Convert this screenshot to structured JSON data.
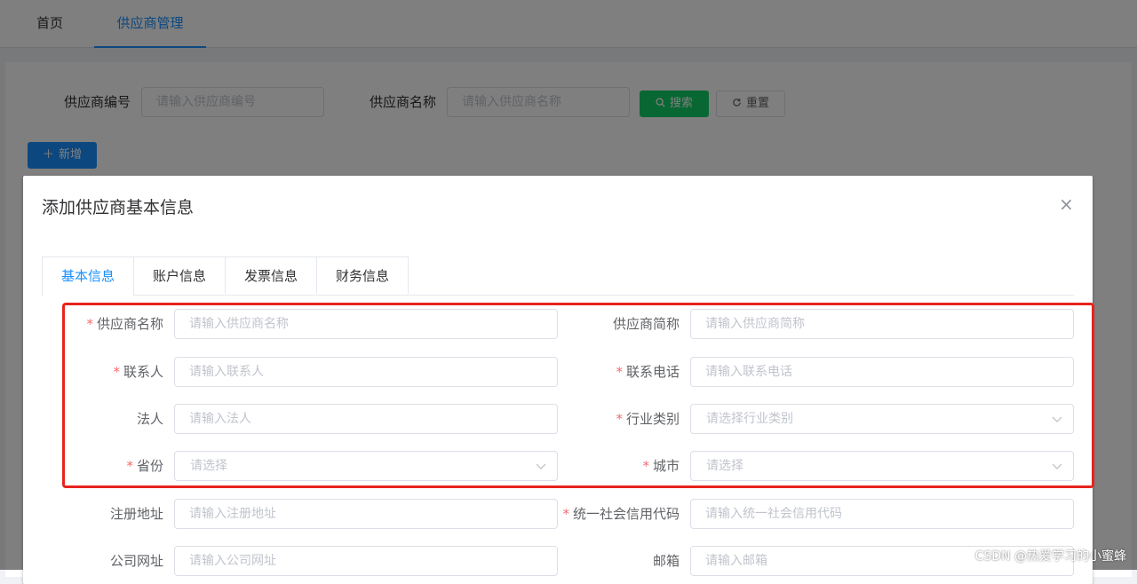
{
  "top_tabs": [
    {
      "label": "首页",
      "active": false
    },
    {
      "label": "供应商管理",
      "active": true
    }
  ],
  "search": {
    "code_label": "供应商编号",
    "code_placeholder": "请输入供应商编号",
    "name_label": "供应商名称",
    "name_placeholder": "请输入供应商名称",
    "search_button": "搜索",
    "reset_button": "重置",
    "add_button": "新增"
  },
  "dialog": {
    "title": "添加供应商基本信息",
    "close_icon": "×",
    "tabs": [
      "基本信息",
      "账户信息",
      "发票信息",
      "财务信息"
    ],
    "active_tab": "基本信息",
    "fields": {
      "supplier_name": {
        "label": "供应商名称",
        "required": true,
        "placeholder": "请输入供应商名称"
      },
      "supplier_short": {
        "label": "供应商简称",
        "required": false,
        "placeholder": "请输入供应商简称"
      },
      "contact": {
        "label": "联系人",
        "required": true,
        "placeholder": "请输入联系人"
      },
      "phone": {
        "label": "联系电话",
        "required": true,
        "placeholder": "请输入联系电话"
      },
      "legal_person": {
        "label": "法人",
        "required": false,
        "placeholder": "请输入法人"
      },
      "industry": {
        "label": "行业类别",
        "required": true,
        "placeholder": "请选择行业类别"
      },
      "province": {
        "label": "省份",
        "required": true,
        "placeholder": "请选择"
      },
      "city": {
        "label": "城市",
        "required": true,
        "placeholder": "请选择"
      },
      "address": {
        "label": "注册地址",
        "required": false,
        "placeholder": "请输入注册地址"
      },
      "credit_code": {
        "label": "统一社会信用代码",
        "required": true,
        "placeholder": "请输入统一社会信用代码"
      },
      "website": {
        "label": "公司网址",
        "required": false,
        "placeholder": "请输入公司网址"
      },
      "email": {
        "label": "邮箱",
        "required": false,
        "placeholder": "请输入邮箱"
      }
    },
    "required_mark": "*"
  },
  "watermark": "CSDN @热爱学习的小蜜蜂",
  "colors": {
    "primary": "#1890ff",
    "search_button": "#13ce66",
    "required": "#f56c6c",
    "highlight": "#e8231d"
  }
}
